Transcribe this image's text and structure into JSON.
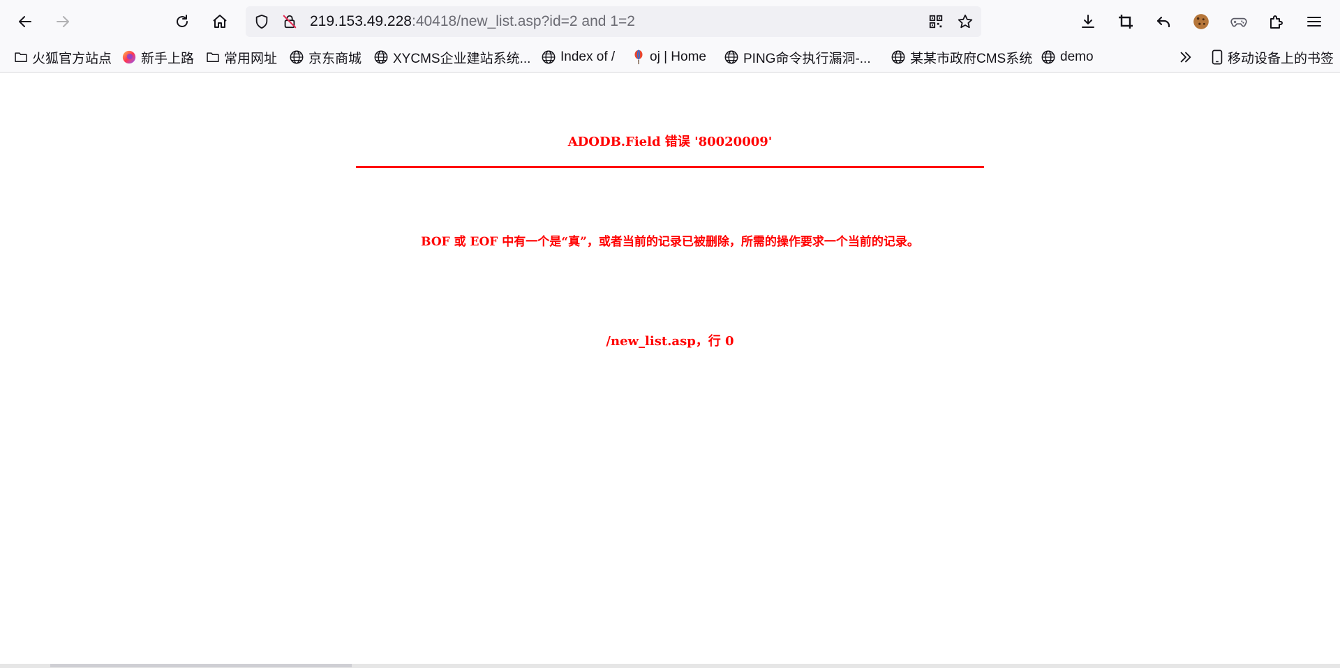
{
  "browser": {
    "url_host": "219.153.49.228",
    "url_path": ":40418/new_list.asp?id=2 and 1=2"
  },
  "bookmarks": {
    "items": [
      {
        "label": "火狐官方站点",
        "icon": "folder-icon"
      },
      {
        "label": "新手上路",
        "icon": "firefox-icon"
      },
      {
        "label": "常用网址",
        "icon": "folder-icon"
      },
      {
        "label": "京东商城",
        "icon": "globe-icon"
      },
      {
        "label": "XYCMS企业建站系统...",
        "icon": "globe-icon"
      },
      {
        "label": "Index of /",
        "icon": "globe-icon"
      },
      {
        "label": "oj | Home",
        "icon": "balloon-icon"
      },
      {
        "label": "PING命令执行漏洞-...",
        "icon": "globe-icon"
      },
      {
        "label": "某某市政府CMS系统",
        "icon": "globe-icon"
      },
      {
        "label": "demo",
        "icon": "globe-icon"
      }
    ],
    "overflow_icon": "chevrons-right-icon",
    "mobile_label": "移动设备上的书签"
  },
  "page": {
    "error_title": "ADODB.Field 错误 '80020009'",
    "error_message": "BOF 或 EOF 中有一个是“真”，或者当前的记录已被删除，所需的操作要求一个当前的记录。",
    "error_location": "/new_list.asp，行 0"
  },
  "colors": {
    "error": "#ff0000",
    "toolbar": "#f9f9fb",
    "urlbar": "#f0f0f4"
  }
}
